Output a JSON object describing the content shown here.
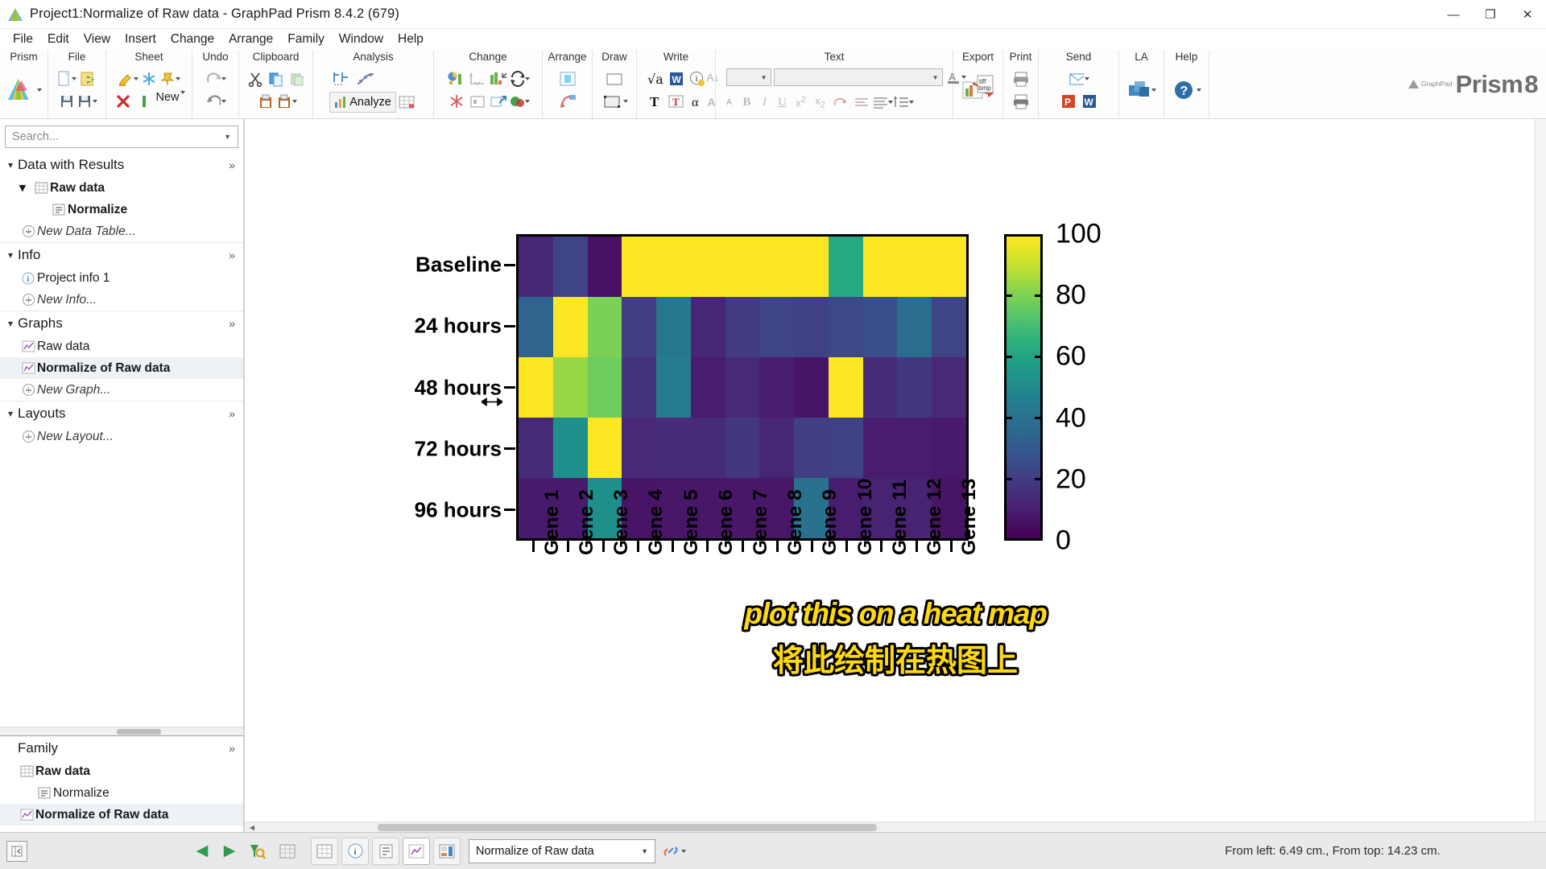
{
  "window": {
    "title": "Project1:Normalize of Raw data - GraphPad Prism 8.4.2 (679)",
    "minimize": "—",
    "maximize": "❐",
    "close": "✕"
  },
  "menubar": [
    "File",
    "Edit",
    "View",
    "Insert",
    "Change",
    "Arrange",
    "Family",
    "Window",
    "Help"
  ],
  "ribbon": {
    "groups": [
      "Prism",
      "File",
      "Sheet",
      "Undo",
      "Clipboard",
      "Analysis",
      "Change",
      "Arrange",
      "Draw",
      "Write",
      "Text",
      "Export",
      "Print",
      "Send",
      "LA",
      "Help"
    ],
    "brand": "Prism",
    "brand_version": "8",
    "brand_sub": "GraphPad",
    "font_size_value": "",
    "font_name_value": ""
  },
  "sidebar": {
    "search_placeholder": "Search...",
    "sections": [
      {
        "title": "Data with Results",
        "expand": "»",
        "items": [
          {
            "label": "Raw data",
            "icon": "table-icon",
            "indent": 1,
            "bold": true,
            "chevron": true
          },
          {
            "label": "Normalize",
            "icon": "results-icon",
            "indent": 2,
            "bold": true
          },
          {
            "label": "New Data Table...",
            "icon": "plus-icon",
            "indent": 1,
            "italic": true
          }
        ]
      },
      {
        "title": "Info",
        "expand": "»",
        "items": [
          {
            "label": "Project info 1",
            "icon": "info-icon",
            "indent": 1
          },
          {
            "label": "New Info...",
            "icon": "plus-icon",
            "indent": 1,
            "italic": true
          }
        ]
      },
      {
        "title": "Graphs",
        "expand": "»",
        "items": [
          {
            "label": "Raw data",
            "icon": "graph-icon",
            "indent": 1
          },
          {
            "label": "Normalize of Raw data",
            "icon": "graph-icon",
            "indent": 1,
            "bold": true,
            "selected": true
          },
          {
            "label": "New Graph...",
            "icon": "plus-icon",
            "indent": 1,
            "italic": true
          }
        ]
      },
      {
        "title": "Layouts",
        "expand": "»",
        "items": [
          {
            "label": "New Layout...",
            "icon": "plus-icon",
            "indent": 1,
            "italic": true
          }
        ]
      }
    ],
    "family": {
      "title": "Family",
      "expand": "»",
      "items": [
        {
          "label": "Raw data",
          "icon": "table-icon",
          "indent": 0,
          "bold": true
        },
        {
          "label": "Normalize",
          "icon": "results-icon",
          "indent": 1,
          "bold": false
        },
        {
          "label": "Normalize of Raw data",
          "icon": "graph-icon",
          "indent": 0,
          "bold": true,
          "selected": true
        }
      ]
    }
  },
  "caption": {
    "english": "plot this on a heat map",
    "chinese": "将此绘制在热图上"
  },
  "statusbar": {
    "nav_prev": "◀",
    "nav_next": "▶",
    "sheet_selector_value": "Normalize of Raw data",
    "position_text": "From left: 6.49 cm., From top: 14.23 cm."
  },
  "chart_data": {
    "type": "heatmap",
    "title": "",
    "xlabel": "",
    "ylabel": "",
    "colormap": "viridis",
    "colorbar": {
      "min": 0,
      "max": 100,
      "ticks": [
        100,
        80,
        60,
        40,
        20,
        0
      ],
      "tick_labels": [
        "100",
        "80",
        "60",
        "40",
        "20",
        "0"
      ]
    },
    "categories": [
      "Gene 1",
      "Gene 2",
      "Gene 3",
      "Gene 4",
      "Gene 5",
      "Gene 6",
      "Gene 7",
      "Gene 8",
      "Gene 9",
      "Gene 10",
      "Gene 11",
      "Gene 12",
      "Gene 13"
    ],
    "rows": [
      "Baseline",
      "24 hours",
      "48 hours",
      "72 hours",
      "96 hours"
    ],
    "values": [
      [
        12,
        22,
        5,
        100,
        100,
        100,
        100,
        100,
        100,
        62,
        100,
        100,
        100
      ],
      [
        34,
        100,
        80,
        20,
        42,
        12,
        19,
        22,
        21,
        24,
        26,
        38,
        22
      ],
      [
        100,
        84,
        78,
        16,
        44,
        9,
        13,
        9,
        6,
        100,
        14,
        18,
        13
      ],
      [
        14,
        52,
        100,
        13,
        14,
        14,
        18,
        12,
        20,
        21,
        9,
        9,
        8
      ],
      [
        8,
        8,
        52,
        6,
        7,
        7,
        7,
        7,
        40,
        9,
        11,
        11,
        6
      ]
    ]
  }
}
